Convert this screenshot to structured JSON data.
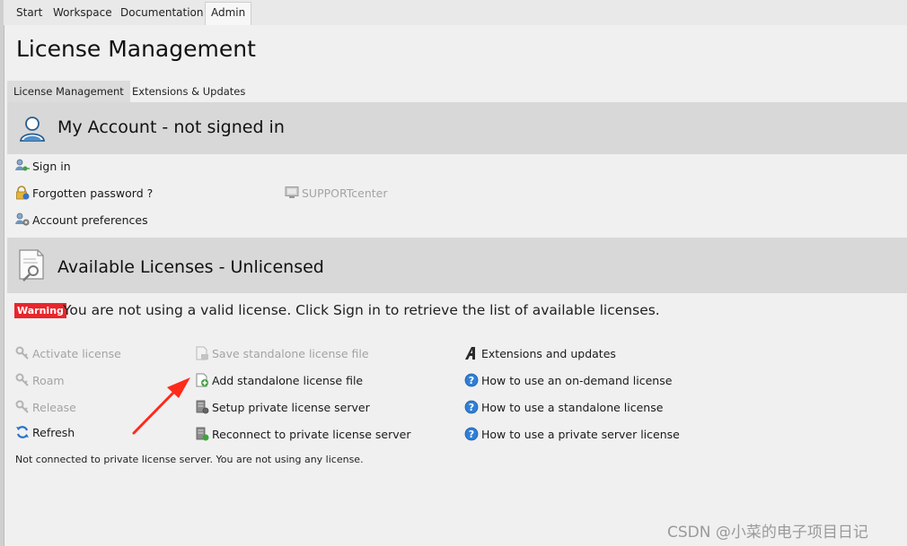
{
  "top_tabs": {
    "start": "Start",
    "workspace": "Workspace",
    "documentation": "Documentation",
    "admin": "Admin"
  },
  "page_title": "License Management",
  "sub_tabs": {
    "license_management": "License Management",
    "extensions_updates": "Extensions & Updates"
  },
  "my_account": {
    "title": "My Account - not signed in",
    "sign_in": "Sign in",
    "forgotten_password": "Forgotten password ?",
    "account_preferences": "Account preferences",
    "supportcenter": "SUPPORTcenter"
  },
  "available_licenses": {
    "title": "Available Licenses - Unlicensed",
    "warning_badge": "Warning",
    "warning_text": "You are not using a valid license. Click Sign in to retrieve the list of available licenses.",
    "col1": {
      "activate": "Activate license",
      "roam": "Roam",
      "release": "Release",
      "refresh": "Refresh"
    },
    "col2": {
      "save_standalone": "Save standalone license file",
      "add_standalone": "Add standalone license file",
      "setup_private": "Setup private license server",
      "reconnect_private": "Reconnect to private license server"
    },
    "col3": {
      "extensions": "Extensions and updates",
      "howto_ondemand": "How to use an on-demand license",
      "howto_standalone": "How to use a standalone license",
      "howto_private": "How to use a private server license"
    },
    "status": "Not connected to private license server. You are not using any license."
  },
  "watermark": "CSDN @小菜的电子项目日记",
  "colors": {
    "warning": "#e8262c",
    "section_band": "#d8d8d8",
    "arrow": "#ff2a1a",
    "help_icon": "#2f7fd6"
  },
  "annotation_arrow": "red arrow pointing to Add standalone license file"
}
